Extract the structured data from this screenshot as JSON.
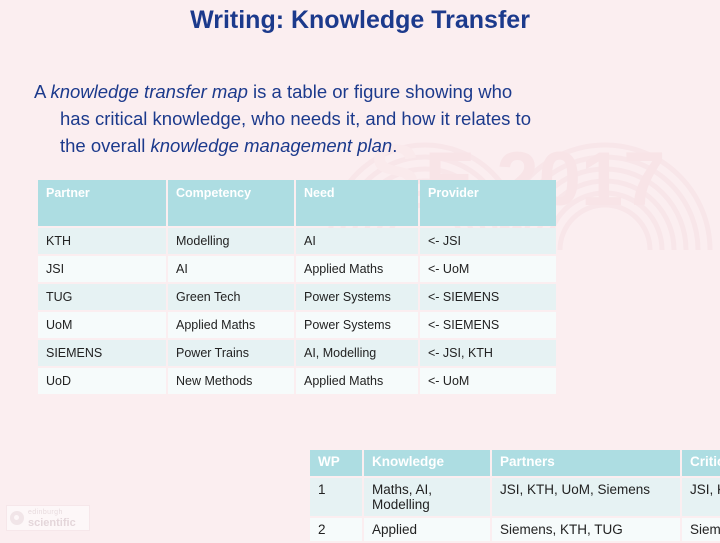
{
  "slide": {
    "title": "Writing: Knowledge Transfer",
    "title_color": "#1c3a8c",
    "background_color": "#fbeef0"
  },
  "body": {
    "line1_a": "A ",
    "line1_em": "knowledge transfer map",
    "line1_b": " is a table or figure showing who",
    "line2": "has critical knowledge, who needs it, and how it relates to",
    "line3_a": "the overall ",
    "line3_em": "knowledge management plan",
    "line3_b": "."
  },
  "watermark": {
    "text": "E 2017",
    "color": "#f7e3e6"
  },
  "partner_table": {
    "header_color": "#addde2",
    "headers": [
      "Partner",
      "Competency",
      "Need",
      "Provider"
    ],
    "rows": [
      [
        "KTH",
        "Modelling",
        "AI",
        "<- JSI"
      ],
      [
        "JSI",
        "AI",
        "Applied Maths",
        "<- UoM"
      ],
      [
        "TUG",
        "Green Tech",
        "Power Systems",
        "<- SIEMENS"
      ],
      [
        "UoM",
        "Applied Maths",
        "Power Systems",
        "<- SIEMENS"
      ],
      [
        "SIEMENS",
        "Power Trains",
        "AI, Modelling",
        "<- JSI, KTH"
      ],
      [
        "UoD",
        "New Methods",
        "Applied Maths",
        "<- UoM"
      ]
    ]
  },
  "wp_table": {
    "header_color": "#addde2",
    "headers": [
      "WP",
      "Knowledge",
      "Partners",
      "Critical"
    ],
    "rows": [
      [
        "1",
        "Maths, AI, Modelling",
        "JSI, KTH, UoM, Siemens",
        "JSI, KTH, UoM"
      ],
      [
        "2",
        "Applied",
        "Siemens, KTH, TUG",
        "Siem"
      ]
    ]
  },
  "logo": {
    "line1": "edinburgh",
    "line2": "scientific"
  }
}
